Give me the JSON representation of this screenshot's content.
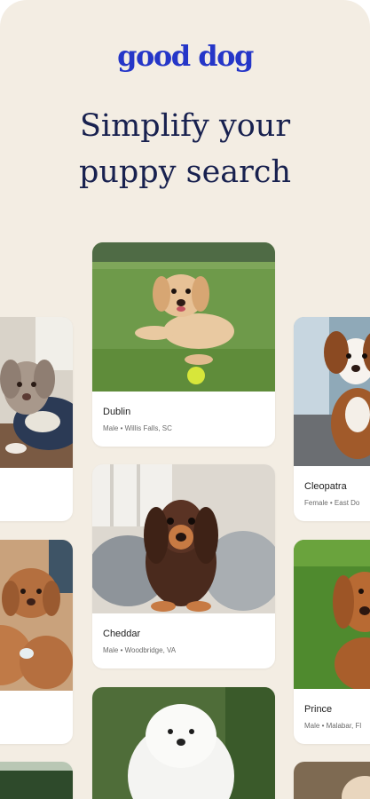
{
  "header": {
    "logo": "good dog",
    "headline_line1": "Simplify your",
    "headline_line2": "puppy search"
  },
  "cards": [
    {
      "name": "Dublin",
      "meta": "Male • Willis Falls, SC",
      "photo": "golden-retriever-puppy-with-tennis-ball"
    },
    {
      "name": "Cheddar",
      "meta": "Male • Woodbridge, VA",
      "photo": "dachshund-puppy-on-pillows"
    },
    {
      "name": "Cleopatra",
      "meta": "Female • East Do",
      "photo": "cavalier-puppy"
    },
    {
      "name": "Prince",
      "meta": "Male • Malabar, Fl",
      "photo": "red-puppy-on-grass"
    },
    {
      "photo": "merle-doodle-puppy-on-blanket"
    },
    {
      "photo": "doodle-puppies-group"
    },
    {
      "photo": "white-samoyed-puppy"
    }
  ],
  "colors": {
    "background": "#f3ede3",
    "logo": "#2536c8",
    "headline": "#18214f",
    "card": "#ffffff"
  }
}
